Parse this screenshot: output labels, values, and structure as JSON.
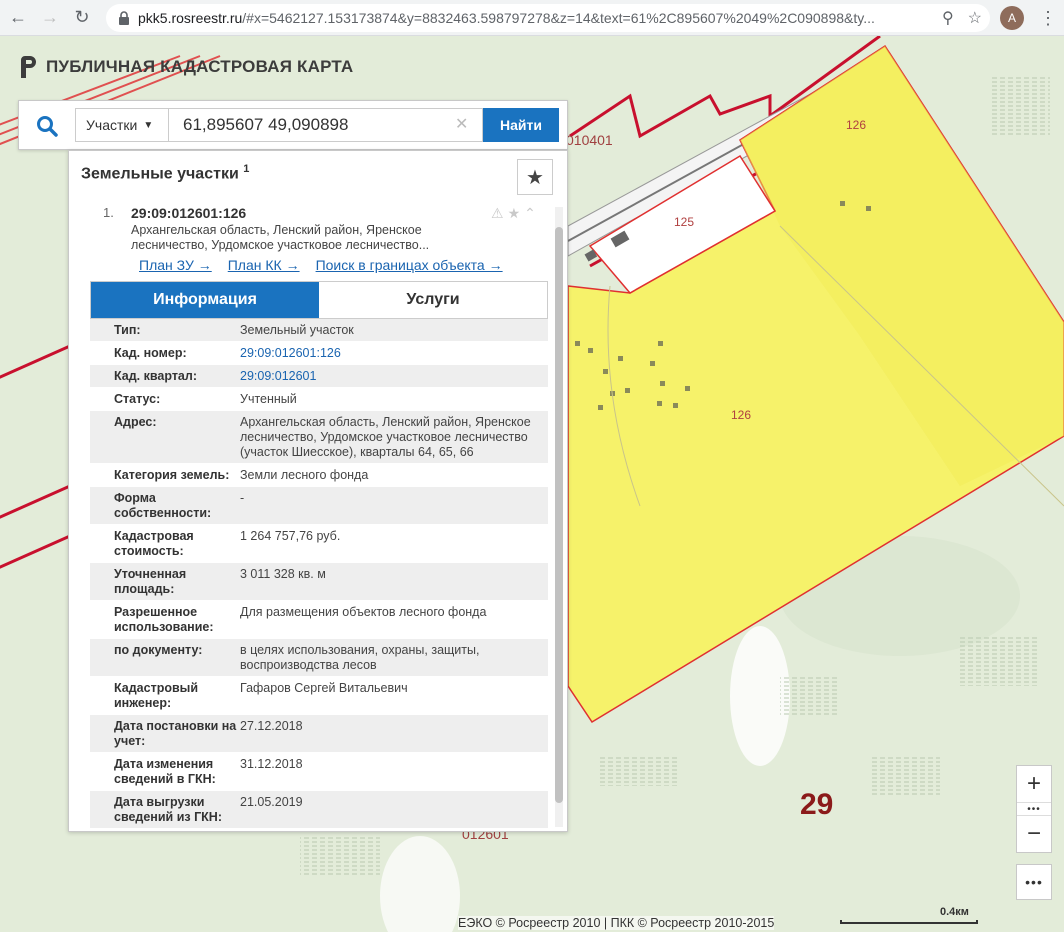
{
  "browser": {
    "url_host": "pkk5.rosreestr.ru",
    "url_rest": "/#x=5462127.153173874&y=8832463.598797278&z=14&text=61%2C895607%2049%2C090898&ty...",
    "avatar_letter": "A"
  },
  "app": {
    "title": "ПУБЛИЧНАЯ КАДАСТРОВАЯ КАРТА"
  },
  "search": {
    "type_label": "Участки",
    "query": "61,895607 49,090898",
    "find_label": "Найти"
  },
  "panel": {
    "heading": "Земельные участки",
    "heading_count": "1",
    "result": {
      "number": "1.",
      "title": "29:09:012601:126",
      "address": "Архангельская область, Ленский район, Яренское лесничество, Урдомское участковое лесничество..."
    },
    "links": [
      "План ЗУ →",
      "План КК →",
      "Поиск в границах объекта →"
    ],
    "tabs": [
      "Информация",
      "Услуги"
    ],
    "rows": [
      {
        "k": "Тип:",
        "v": "Земельный участок"
      },
      {
        "k": "Кад. номер:",
        "v": "29:09:012601:126"
      },
      {
        "k": "Кад. квартал:",
        "v": "29:09:012601"
      },
      {
        "k": "Статус:",
        "v": "Учтенный"
      },
      {
        "k": "Адрес:",
        "v": "Архангельская область, Ленский район, Яренское лесничество, Урдомское участковое лесничество (участок Шиесское), кварталы 64, 65, 66"
      },
      {
        "k": "Категория земель:",
        "v": "Земли лесного фонда"
      },
      {
        "k": "Форма собственности:",
        "v": "-"
      },
      {
        "k": "Кадастровая стоимость:",
        "v": "1 264 757,76 руб."
      },
      {
        "k": "Уточненная площадь:",
        "v": "3 011 328 кв. м"
      },
      {
        "k": "Разрешенное использование:",
        "v": "Для размещения объектов лесного фонда"
      },
      {
        "k": "по документу:",
        "v": "в целях использования, охраны, защиты, воспроизводства лесов"
      },
      {
        "k": "Кадастровый инженер:",
        "v": "Гафаров Сергей Витальевич"
      },
      {
        "k": "Дата постановки на учет:",
        "v": "27.12.2018"
      },
      {
        "k": "Дата изменения сведений в ГКН:",
        "v": "31.12.2018"
      },
      {
        "k": "Дата выгрузки сведений из ГКН:",
        "v": "21.05.2019"
      }
    ]
  },
  "map": {
    "labels": {
      "q010401": "010401",
      "p126_top": "126",
      "p125": "125",
      "p126_mid": "126",
      "region": "29",
      "q012601": "012601"
    },
    "attribution": "ЕЭКО © Росреестр 2010 | ПКК © Росреестр 2010-2015",
    "scale": "0.4км",
    "colors": {
      "parcel_fill": "#f6f26a",
      "parcel_border": "#e03030",
      "quarter_border": "#c8102e",
      "accent": "#1a73c0"
    }
  }
}
